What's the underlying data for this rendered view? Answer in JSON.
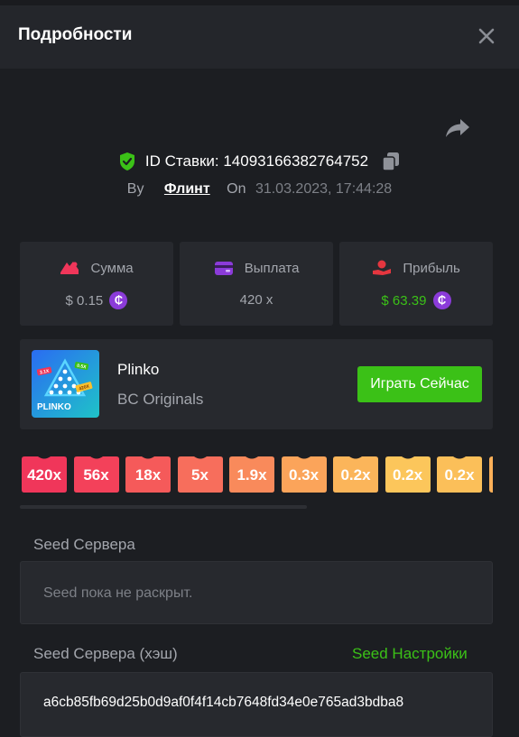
{
  "header": {
    "title": "Подробности"
  },
  "bet": {
    "id_label": "ID Ставки: 14093166382764752",
    "by_label": "By",
    "user": "Флинт",
    "on_label": "On",
    "date": "31.03.2023, 17:44:28"
  },
  "stats": {
    "amount": {
      "label": "Сумма",
      "value": "$ 0.15"
    },
    "payout": {
      "label": "Выплата",
      "value": "420 x"
    },
    "profit": {
      "label": "Прибыль",
      "value": "$ 63.39"
    }
  },
  "game": {
    "name": "Plinko",
    "provider": "BC Originals",
    "play_label": "Играть Сейчас",
    "thumb_text": "PLINKO",
    "thumb_tags": [
      "2.1X",
      "0.5X",
      "420X"
    ]
  },
  "multipliers": [
    "420x",
    "56x",
    "18x",
    "5x",
    "1.9x",
    "0.3x",
    "0.2x",
    "0.2x",
    "0.2x"
  ],
  "multiplier_colors": [
    "#f0365a",
    "#f3415a",
    "#f55a5a",
    "#f76e5c",
    "#f98a5b",
    "#fba45a",
    "#fbb55a",
    "#fcc65b",
    "#fbbf59",
    "#fbb058"
  ],
  "seeds": {
    "server_label": "Seed Сервера",
    "server_value": "Seed пока не раскрыт.",
    "hash_label": "Seed Сервера (хэш)",
    "settings_label": "Seed Настройки",
    "hash_value": "a6cb85fb69d25b0d9af0f4f14cb7648fd34e0e765ad3bdba8"
  },
  "colors": {
    "accent_green": "#3bc117",
    "coin_purple": "#8b3bd9",
    "panel": "#27292e",
    "background": "#1c1e22"
  },
  "icons": [
    "close-icon",
    "share-icon",
    "shield-check-icon",
    "copy-icon",
    "amount-icon",
    "wallet-icon",
    "profit-icon",
    "coin-icon"
  ]
}
